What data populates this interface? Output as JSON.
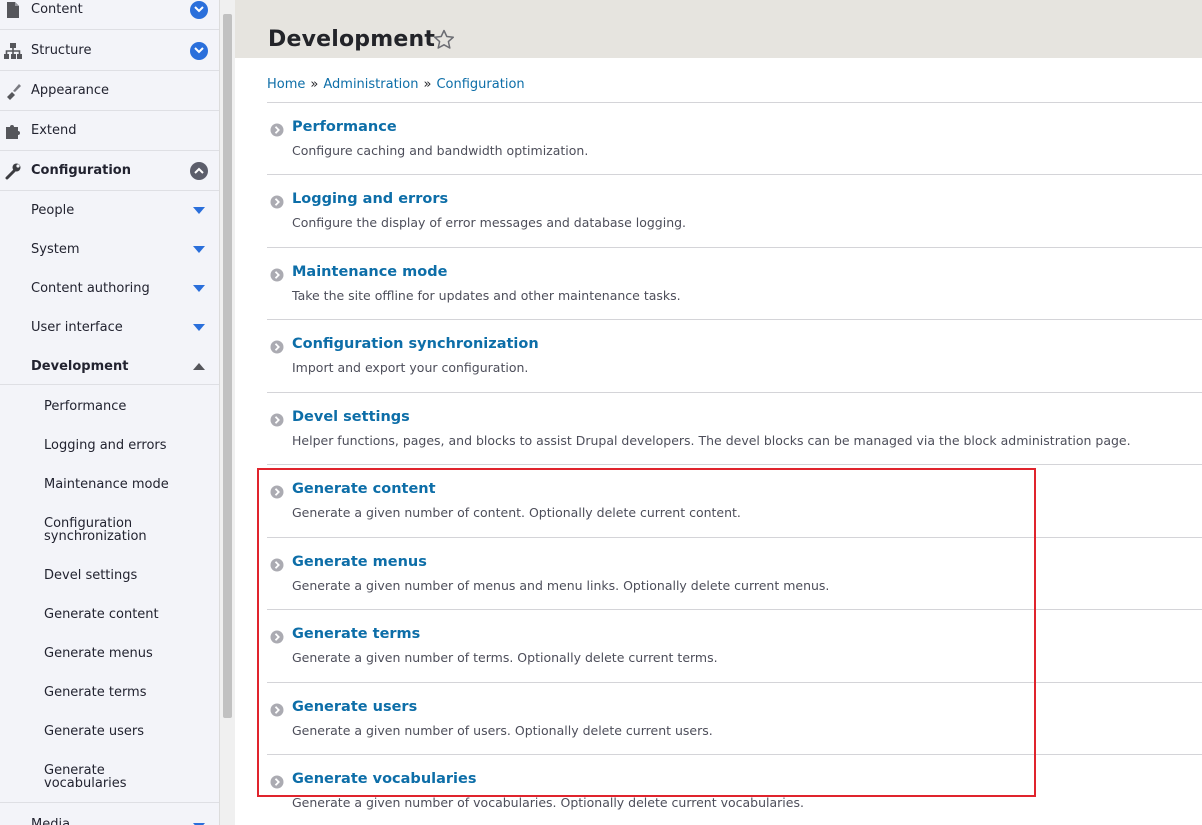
{
  "sidebar": {
    "top_items": [
      {
        "label": "Content",
        "icon": "document-icon"
      },
      {
        "label": "Structure",
        "icon": "sitemap-icon"
      },
      {
        "label": "Appearance",
        "icon": "brush-icon"
      },
      {
        "label": "Extend",
        "icon": "puzzle-icon"
      },
      {
        "label": "Configuration",
        "icon": "wrench-icon"
      }
    ],
    "config_sub_items": [
      {
        "label": "People"
      },
      {
        "label": "System"
      },
      {
        "label": "Content authoring"
      },
      {
        "label": "User interface"
      },
      {
        "label": "Development"
      }
    ],
    "development_items": [
      {
        "label": "Performance"
      },
      {
        "label": "Logging and errors"
      },
      {
        "label": "Maintenance mode"
      },
      {
        "label": "Configuration synchronization"
      },
      {
        "label": "Devel settings"
      },
      {
        "label": "Generate content"
      },
      {
        "label": "Generate menus"
      },
      {
        "label": "Generate terms"
      },
      {
        "label": "Generate users"
      },
      {
        "label": "Generate vocabularies"
      }
    ],
    "bottom_item": {
      "label": "Media"
    }
  },
  "header": {
    "title": "Development"
  },
  "breadcrumb": {
    "items": [
      "Home",
      "Administration",
      "Configuration"
    ],
    "separator": "»"
  },
  "entries": [
    {
      "title": "Performance",
      "description": "Configure caching and bandwidth optimization."
    },
    {
      "title": "Logging and errors",
      "description": "Configure the display of error messages and database logging."
    },
    {
      "title": "Maintenance mode",
      "description": "Take the site offline for updates and other maintenance tasks."
    },
    {
      "title": "Configuration synchronization",
      "description": "Import and export your configuration."
    },
    {
      "title": "Devel settings",
      "description": "Helper functions, pages, and blocks to assist Drupal developers. The devel blocks can be managed via the block administration page."
    },
    {
      "title": "Generate content",
      "description": "Generate a given number of content. Optionally delete current content."
    },
    {
      "title": "Generate menus",
      "description": "Generate a given number of menus and menu links. Optionally delete current menus."
    },
    {
      "title": "Generate terms",
      "description": "Generate a given number of terms. Optionally delete current terms."
    },
    {
      "title": "Generate users",
      "description": "Generate a given number of users. Optionally delete current users."
    },
    {
      "title": "Generate vocabularies",
      "description": "Generate a given number of vocabularies. Optionally delete current vocabularies."
    }
  ],
  "colors": {
    "link": "#0d6ea8",
    "toggle_blue": "#2a6fdb",
    "highlight_border": "#e0242d",
    "header_bg": "#e6e4df",
    "sidebar_bg": "#f3f4f9"
  }
}
